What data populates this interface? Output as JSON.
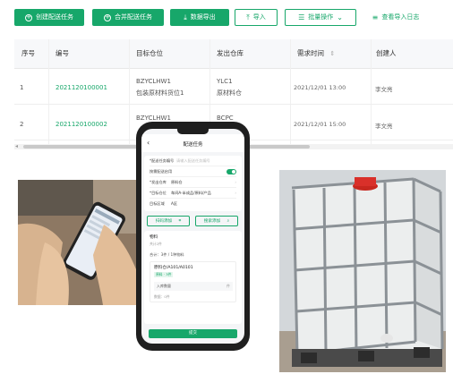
{
  "toolbar": {
    "create_label": "创建配送任务",
    "merge_label": "合并配送任务",
    "export_label": "数据导出",
    "import_label": "导入",
    "batch_label": "批量操作",
    "log_label": "查看导入日志",
    "accent_color": "#17a76a"
  },
  "table": {
    "headers": [
      "序号",
      "编号",
      "目标仓位",
      "发出仓库",
      "需求时间",
      "创建人"
    ],
    "rows": [
      {
        "index": "1",
        "code": "2021120100001",
        "target_code": "BZYCLHW1",
        "target_name": "包装原材料货位1",
        "warehouse_code": "YLC1",
        "warehouse_name": "原材料仓",
        "time": "2021/12/01  13:00",
        "creator": "李文亮"
      },
      {
        "index": "2",
        "code": "2021120100002",
        "target_code": "BZYCLHW1",
        "warehouse_code": "BCPC",
        "time": "2021/12/01  15:00",
        "creator": "李文亮"
      }
    ]
  },
  "mobile": {
    "title": "配送任务",
    "fields": [
      {
        "label": "*配送任务编号",
        "value": "请输入配送任务编号"
      },
      {
        "label": "按需配送启用",
        "value": ""
      },
      {
        "label": "*发出仓库",
        "value": "原料仓"
      },
      {
        "label": "*目标仓位",
        "value": "车间A-半成品/原料/产品"
      },
      {
        "label": "目标区域",
        "value": "A区"
      }
    ],
    "scan_receive_label": "扫码添加",
    "search_add_label": "搜索添加",
    "detail_title": "物料",
    "detail_sub": "共计2件",
    "group_label": "合计：3件 / 1种物料",
    "item_title": "原料仓/A101/A0101",
    "item_tag": "原料 · 3件",
    "qty_label": "入库数量",
    "qty_unit": "件",
    "footer_note": "数据：0件",
    "submit_label": "提交"
  },
  "icons": [
    "plus-circle-icon",
    "plus-circle-icon",
    "download-icon",
    "upload-icon",
    "sliders-icon",
    "chevron-down-icon",
    "list-icon",
    "sort-icon",
    "back-arrow-icon",
    "scan-icon",
    "search-icon"
  ]
}
